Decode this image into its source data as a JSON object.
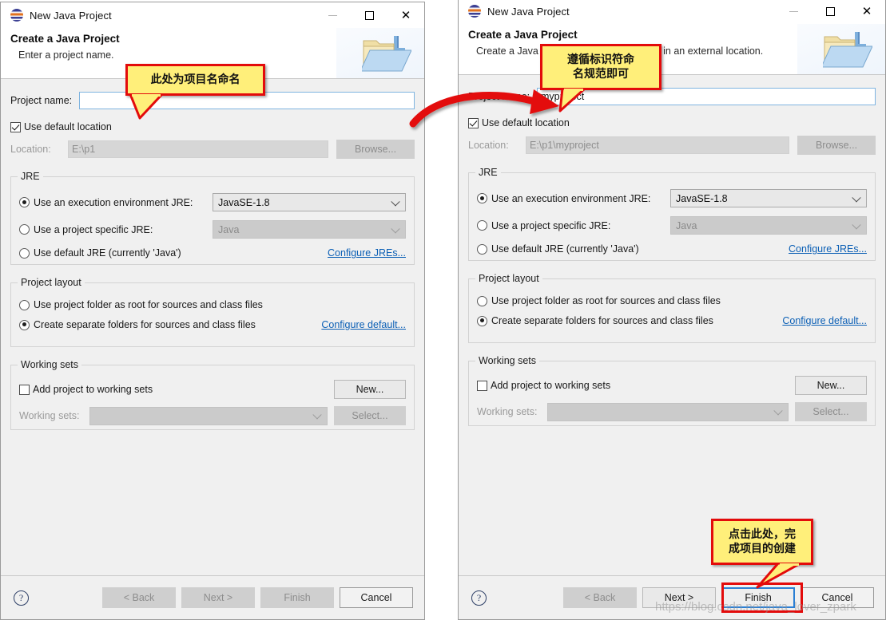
{
  "dialogs": [
    {
      "id": "left",
      "titlebar": {
        "title": "New Java Project",
        "icon": "java-project-icon",
        "minimize": "—",
        "maximize": "□",
        "close": "✕"
      },
      "header": {
        "title": "Create a Java Project",
        "subtitle": "Enter a project name.",
        "banner_icon": "java-folder-icon"
      },
      "project_name": {
        "label": "Project name:",
        "value": "",
        "placeholder": ""
      },
      "use_default_location": {
        "label": "Use default location",
        "checked": true
      },
      "location": {
        "label": "Location:",
        "value": "E:\\p1",
        "browse_label": "Browse..."
      },
      "jre": {
        "group_title": "JRE",
        "options": [
          {
            "label": "Use an execution environment JRE:",
            "selected": true
          },
          {
            "label": "Use a project specific JRE:",
            "selected": false
          },
          {
            "label": "Use default JRE (currently 'Java')",
            "selected": false
          }
        ],
        "execution_env_value": "JavaSE-1.8",
        "specific_jre_value": "Java",
        "configure_link": "Configure JREs..."
      },
      "project_layout": {
        "group_title": "Project layout",
        "options": [
          {
            "label": "Use project folder as root for sources and class files",
            "selected": false
          },
          {
            "label": "Create separate folders for sources and class files",
            "selected": true
          }
        ],
        "configure_link": "Configure default..."
      },
      "working_sets": {
        "group_title": "Working sets",
        "add_label": "Add project to working sets",
        "add_checked": false,
        "sets_label": "Working sets:",
        "sets_value": "",
        "new_label": "New...",
        "select_label": "Select..."
      },
      "footer": {
        "help_icon": "?",
        "buttons": [
          {
            "label": "< Back",
            "enabled": false,
            "focused": false
          },
          {
            "label": "Next >",
            "enabled": false,
            "focused": false
          },
          {
            "label": "Finish",
            "enabled": false,
            "focused": false
          },
          {
            "label": "Cancel",
            "enabled": true,
            "focused": false
          }
        ]
      }
    },
    {
      "id": "right",
      "titlebar": {
        "title": "New Java Project",
        "icon": "java-project-icon",
        "minimize": "—",
        "maximize": "□",
        "close": "✕"
      },
      "header": {
        "title": "Create a Java Project",
        "subtitle": "Create a Java project in the workspace or in an external location.",
        "banner_icon": "java-folder-icon"
      },
      "project_name": {
        "label": "Project name:",
        "value": "myproject",
        "placeholder": ""
      },
      "use_default_location": {
        "label": "Use default location",
        "checked": true
      },
      "location": {
        "label": "Location:",
        "value": "E:\\p1\\myproject",
        "browse_label": "Browse..."
      },
      "jre": {
        "group_title": "JRE",
        "options": [
          {
            "label": "Use an execution environment JRE:",
            "selected": true
          },
          {
            "label": "Use a project specific JRE:",
            "selected": false
          },
          {
            "label": "Use default JRE (currently 'Java')",
            "selected": false
          }
        ],
        "execution_env_value": "JavaSE-1.8",
        "specific_jre_value": "Java",
        "configure_link": "Configure JREs..."
      },
      "project_layout": {
        "group_title": "Project layout",
        "options": [
          {
            "label": "Use project folder as root for sources and class files",
            "selected": false
          },
          {
            "label": "Create separate folders for sources and class files",
            "selected": true
          }
        ],
        "configure_link": "Configure default..."
      },
      "working_sets": {
        "group_title": "Working sets",
        "add_label": "Add project to working sets",
        "add_checked": false,
        "sets_label": "Working sets:",
        "sets_value": "",
        "new_label": "New...",
        "select_label": "Select..."
      },
      "footer": {
        "help_icon": "?",
        "buttons": [
          {
            "label": "< Back",
            "enabled": false,
            "focused": false
          },
          {
            "label": "Next >",
            "enabled": true,
            "focused": false
          },
          {
            "label": "Finish",
            "enabled": true,
            "focused": true
          },
          {
            "label": "Cancel",
            "enabled": true,
            "focused": false
          }
        ]
      }
    }
  ],
  "annotations": {
    "callout_1": {
      "line1": "此处为项目名命名",
      "line2": ""
    },
    "callout_2": {
      "line1": "遵循标识符命",
      "line2": "名规范即可"
    },
    "callout_3": {
      "line1": "点击此处，完",
      "line2": "成项目的创建"
    },
    "arrow_color": "#e30b0b",
    "callout_fill": "#ffef7a",
    "callout_border": "#e30b0b"
  },
  "watermark": {
    "text": "https://blog.csdn.net/java_lover_zpark"
  }
}
